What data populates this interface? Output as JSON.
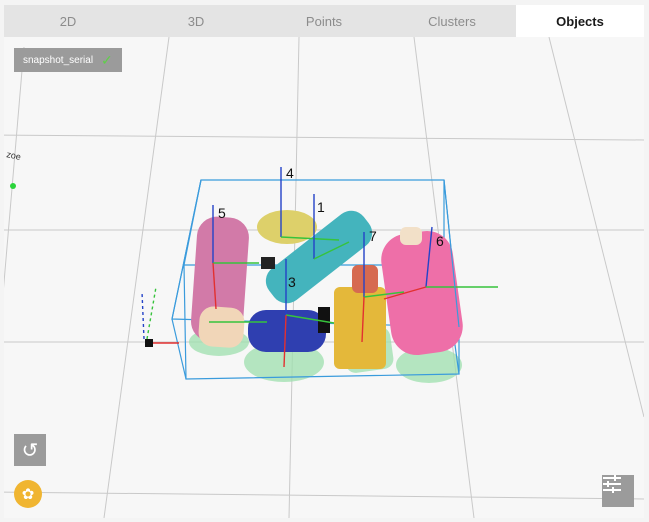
{
  "tabs": [
    {
      "label": "2D"
    },
    {
      "label": "3D"
    },
    {
      "label": "Points"
    },
    {
      "label": "Clusters"
    },
    {
      "label": "Objects",
      "active": true
    }
  ],
  "snapshot_chip": {
    "label": "snapshot_serial",
    "icon": "check-icon"
  },
  "object_labels": [
    "1",
    "3",
    "4",
    "5",
    "6",
    "7"
  ],
  "side_text": "zoe",
  "buttons": {
    "reset": "reset-view-icon",
    "capture": "camera-shutter-icon",
    "settings": "tune-icon"
  },
  "colors": {
    "accent": "#f0b531",
    "bbox": "#3a9bdc",
    "axis_z": "#2443c8",
    "axis_y": "#37c33c",
    "axis_x": "#e23030"
  }
}
